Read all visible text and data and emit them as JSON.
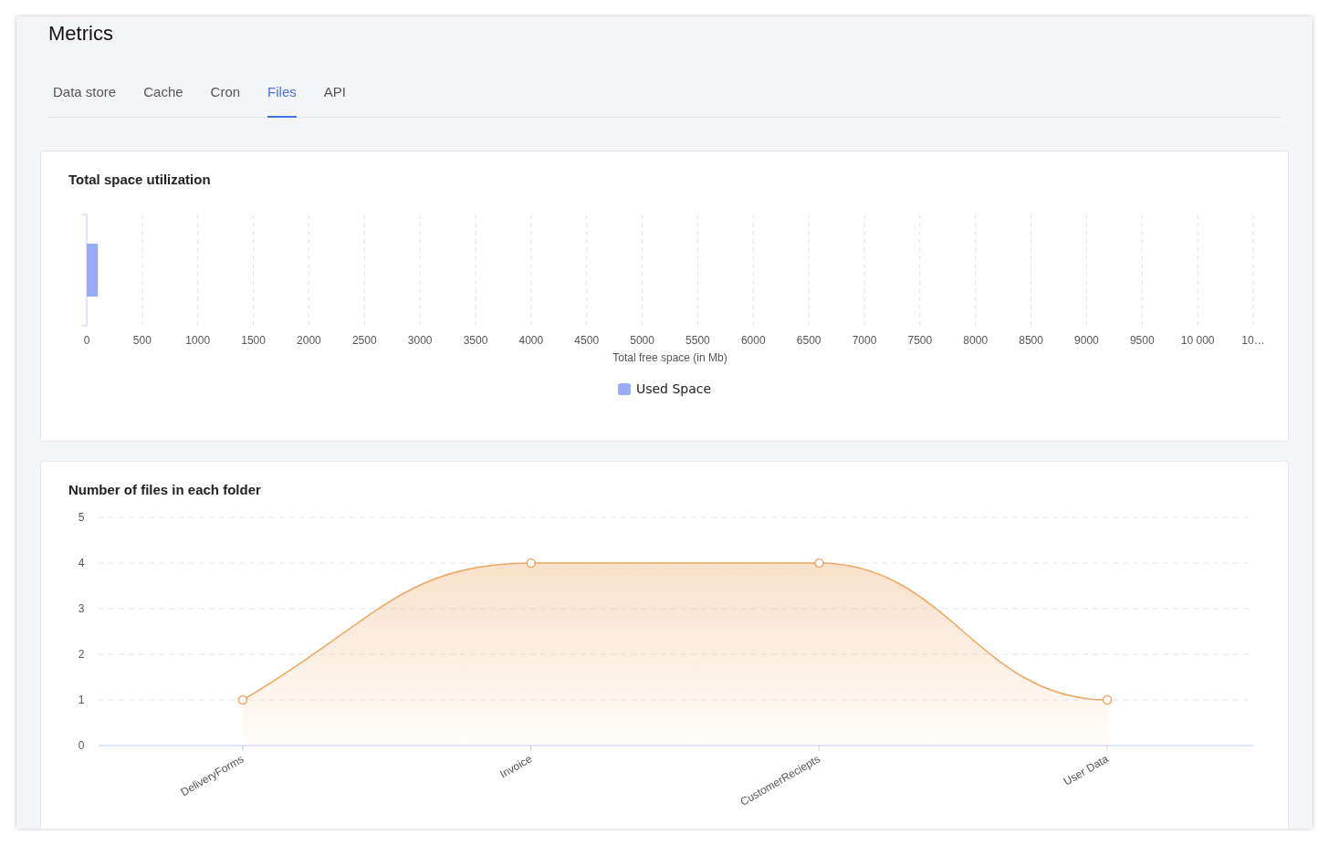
{
  "page": {
    "title": "Metrics"
  },
  "tabs": [
    {
      "label": "Data store",
      "selected": false
    },
    {
      "label": "Cache",
      "selected": false
    },
    {
      "label": "Cron",
      "selected": false
    },
    {
      "label": "Files",
      "selected": true
    },
    {
      "label": "API",
      "selected": false
    }
  ],
  "space_card": {
    "title": "Total space utilization",
    "chart_data": {
      "type": "bar",
      "orientation": "horizontal",
      "xlabel": "Total free space (in Mb)",
      "grid": true,
      "xlim": [
        0,
        10500
      ],
      "xticks": [
        0,
        500,
        1000,
        1500,
        2000,
        2500,
        3000,
        3500,
        4000,
        4500,
        5000,
        5500,
        6000,
        6500,
        7000,
        7500,
        8000,
        8500,
        9000,
        9500,
        {
          "value": 10000,
          "label": "10 000"
        },
        {
          "value": 10500,
          "label": "10…"
        }
      ],
      "series": [
        {
          "name": "Used Space",
          "color": "#9aabf5",
          "values": [
            100
          ]
        }
      ]
    }
  },
  "files_card": {
    "title": "Number of files in each folder",
    "chart_data": {
      "type": "area",
      "categories": [
        "DeliveryForms",
        "Invoice",
        "CustomerReciepts",
        "User Data"
      ],
      "ylim": [
        0,
        5
      ],
      "grid": true,
      "yticks": [
        0,
        1,
        2,
        3,
        4,
        5
      ],
      "series": [
        {
          "color": "#eda865",
          "values": [
            1,
            4,
            4,
            1
          ]
        }
      ]
    }
  }
}
